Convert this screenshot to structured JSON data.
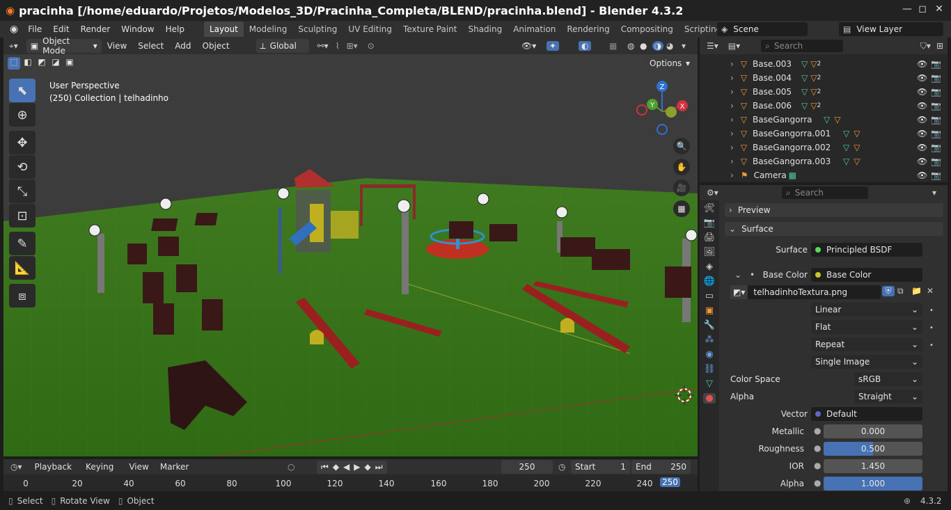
{
  "window": {
    "title": "pracinha [/home/eduardo/Projetos/Modelos_3D/Pracinha_Completa/BLEND/pracinha.blend] - Blender 4.3.2"
  },
  "menubar": {
    "items": [
      "File",
      "Edit",
      "Render",
      "Window",
      "Help"
    ]
  },
  "workspaces": [
    "Layout",
    "Modeling",
    "Sculpting",
    "UV Editing",
    "Texture Paint",
    "Shading",
    "Animation",
    "Rendering",
    "Compositing",
    "Scripting"
  ],
  "active_workspace": "Layout",
  "scene": {
    "name": "Scene",
    "view_layer": "View Layer"
  },
  "viewport_header": {
    "mode": "Object Mode",
    "menus": [
      "View",
      "Select",
      "Add",
      "Object"
    ],
    "transform_orientation": "Global",
    "options_label": "Options"
  },
  "viewport": {
    "perspective": "User Perspective",
    "collection_info": "(250) Collection | telhadinho",
    "gizmo_axes": [
      "Z",
      "Y",
      "X"
    ]
  },
  "outliner": {
    "search_placeholder": "Search",
    "rows": [
      {
        "name": "Base.003",
        "badge": "2"
      },
      {
        "name": "Base.004",
        "badge": "2"
      },
      {
        "name": "Base.005",
        "badge": "2"
      },
      {
        "name": "Base.006",
        "badge": "2"
      },
      {
        "name": "BaseGangorra",
        "badge": ""
      },
      {
        "name": "BaseGangorra.001",
        "badge": ""
      },
      {
        "name": "BaseGangorra.002",
        "badge": ""
      },
      {
        "name": "BaseGangorra.003",
        "badge": ""
      },
      {
        "name": "Camera",
        "badge": ""
      }
    ]
  },
  "properties": {
    "search_placeholder": "Search",
    "sections": {
      "preview": "Preview",
      "surface": "Surface"
    },
    "surface_label": "Surface",
    "surface_value": "Principled BSDF",
    "base_color_label": "Base Color",
    "base_color_value": "Base Color",
    "image_name": "telhadinhoTextura.png",
    "interpolation": "Linear",
    "projection": "Flat",
    "extension": "Repeat",
    "source": "Single Image",
    "color_space_label": "Color Space",
    "color_space_value": "sRGB",
    "alpha_mode_label": "Alpha",
    "alpha_mode_value": "Straight",
    "vector_label": "Vector",
    "vector_value": "Default",
    "metallic_label": "Metallic",
    "metallic_value": "0.000",
    "roughness_label": "Roughness",
    "roughness_value": "0.500",
    "roughness_fraction": 0.5,
    "ior_label": "IOR",
    "ior_value": "1.450",
    "alpha_label": "Alpha",
    "alpha_value": "1.000",
    "alpha_fraction": 1.0
  },
  "timeline": {
    "menus": [
      "Playback",
      "Keying",
      "View",
      "Marker"
    ],
    "current_frame": "250",
    "start_label": "Start",
    "start_value": "1",
    "end_label": "End",
    "end_value": "250",
    "ticks": [
      "0",
      "20",
      "40",
      "60",
      "80",
      "100",
      "120",
      "140",
      "160",
      "180",
      "200",
      "220",
      "240"
    ],
    "playhead": "250"
  },
  "statusbar": {
    "items": [
      "Select",
      "Rotate View",
      "Object"
    ],
    "version": "4.3.2"
  },
  "colors": {
    "accent": "#4772b3",
    "header": "#303030",
    "panel": "#282828",
    "ground": "#3d7a1f"
  }
}
